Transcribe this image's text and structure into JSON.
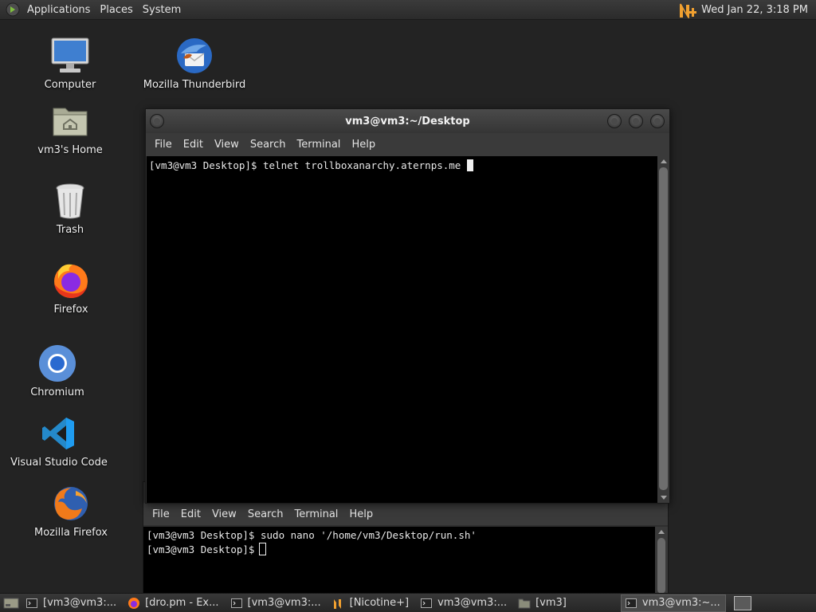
{
  "top_panel": {
    "menu": [
      "Applications",
      "Places",
      "System"
    ],
    "clock": "Wed Jan 22,  3:18 PM"
  },
  "desktop_icons": [
    {
      "label": "Computer",
      "icon": "computer-icon"
    },
    {
      "label": "Mozilla Thunderbird",
      "icon": "thunderbird-icon"
    },
    {
      "label": "vm3's Home",
      "icon": "home-folder-icon"
    },
    {
      "label": "Trash",
      "icon": "trash-icon"
    },
    {
      "label": "Firefox",
      "icon": "firefox-icon"
    },
    {
      "label": "Chromium",
      "icon": "chromium-icon"
    },
    {
      "label": "Visual Studio Code",
      "icon": "vscode-icon"
    },
    {
      "label": "Mozilla Firefox",
      "icon": "firefox-icon"
    }
  ],
  "terminal_front": {
    "title": "vm3@vm3:~/Desktop",
    "menu": [
      "File",
      "Edit",
      "View",
      "Search",
      "Terminal",
      "Help"
    ],
    "lines": [
      "[vm3@vm3 Desktop]$ telnet trollboxanarchy.aternps.me"
    ]
  },
  "terminal_back": {
    "menu": [
      "File",
      "Edit",
      "View",
      "Search",
      "Terminal",
      "Help"
    ],
    "lines": [
      "[vm3@vm3 Desktop]$ sudo nano '/home/vm3/Desktop/run.sh'",
      "[vm3@vm3 Desktop]$"
    ]
  },
  "taskbar": {
    "tasks": [
      {
        "label": "[vm3@vm3:...",
        "icon": "terminal-icon",
        "active": false
      },
      {
        "label": "[dro.pm - Ex...",
        "icon": "firefox-icon",
        "active": false
      },
      {
        "label": "[vm3@vm3:...",
        "icon": "terminal-icon",
        "active": false
      },
      {
        "label": "[Nicotine+]",
        "icon": "nicotine-icon",
        "active": false
      },
      {
        "label": "vm3@vm3:...",
        "icon": "terminal-icon",
        "active": false
      },
      {
        "label": "[vm3]",
        "icon": "folder-icon",
        "active": false
      },
      {
        "label": "vm3@vm3:~...",
        "icon": "terminal-icon",
        "active": true
      }
    ]
  },
  "colors": {
    "desktop_bg": "#232323",
    "panel_bg": "#2f2f2f",
    "terminal_bg": "#000000",
    "nicotine_accent": "#f0a030"
  }
}
